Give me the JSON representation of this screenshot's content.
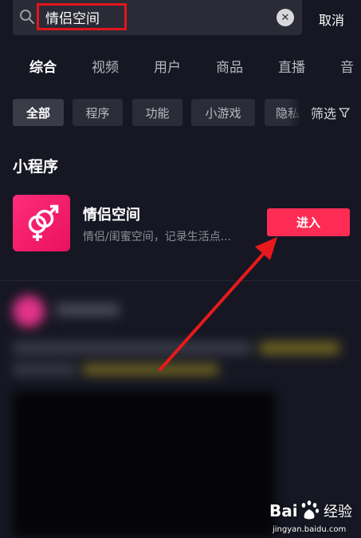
{
  "search": {
    "query": "情侣空间",
    "cancel_label": "取消"
  },
  "tabs": [
    {
      "label": "综合",
      "active": true
    },
    {
      "label": "视频",
      "active": false
    },
    {
      "label": "用户",
      "active": false
    },
    {
      "label": "商品",
      "active": false
    },
    {
      "label": "直播",
      "active": false
    },
    {
      "label": "音",
      "active": false
    }
  ],
  "filters": {
    "chips": [
      "全部",
      "程序",
      "功能",
      "小游戏",
      "隐私"
    ],
    "filter_label": "筛选"
  },
  "section": {
    "title": "小程序"
  },
  "app": {
    "name": "情侣空间",
    "description": "情侣/闺蜜空间，记录生活点...",
    "enter_label": "进入"
  },
  "watermark": {
    "url": "jingyan.baidu.com"
  },
  "colors": {
    "background": "#161723",
    "accent_tab": "#f5c518",
    "enter_button": "#fe2c55",
    "highlight_box": "#e0161b",
    "app_icon": "#ff2d7a"
  }
}
